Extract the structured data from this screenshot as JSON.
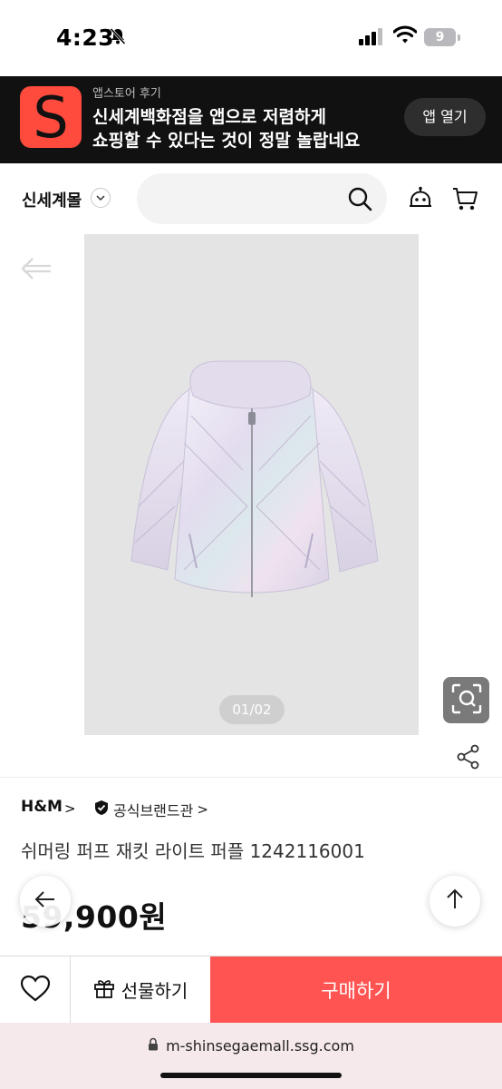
{
  "status_bar": {
    "time": "4:23",
    "battery": "9",
    "icons": [
      "bell-slash-icon",
      "signal-icon",
      "wifi-icon",
      "battery-icon"
    ]
  },
  "app_banner": {
    "icon_letter": "S",
    "sub_label": "앱스토어 후기",
    "line1": "신세계백화점을 앱으로 저렴하게",
    "line2": "쇼핑할 수 있다는 것이 정말 놀랍네요",
    "open_button": "앱 열기",
    "brand_color": "#ff4b3e"
  },
  "header": {
    "brand": "신세계몰",
    "search_placeholder": "",
    "icons": [
      "search-icon",
      "chatbot-icon",
      "cart-icon"
    ]
  },
  "gallery": {
    "page_indicator": "01/02",
    "icons": [
      "back-arrow-icon",
      "lens-search-icon",
      "share-icon"
    ]
  },
  "product": {
    "brand": "H&M",
    "brand_arrow": ">",
    "official_label": "공식브랜드관",
    "official_arrow": ">",
    "title": "쉬머링 퍼프 재킷 라이트 퍼플 1242116001",
    "price": "59,900원"
  },
  "action_bar": {
    "gift_label": "선물하기",
    "buy_label": "구매하기",
    "buy_color": "#ff5452"
  },
  "browser": {
    "url": "m-shinsegaemall.ssg.com"
  }
}
